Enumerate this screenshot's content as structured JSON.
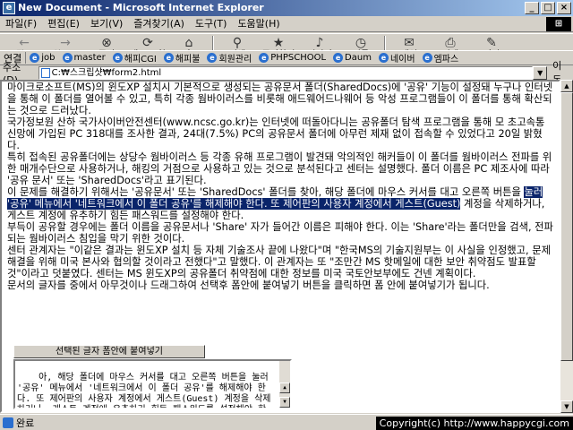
{
  "window": {
    "title": "New Document - Microsoft Internet Explorer",
    "controls": [
      "_",
      "□",
      "×"
    ]
  },
  "menu": [
    "파일(F)",
    "편집(E)",
    "보기(V)",
    "즐겨찾기(A)",
    "도구(T)",
    "도움말(H)"
  ],
  "toolbar": [
    {
      "label": "뒤로",
      "icon": "back-arrow-icon",
      "glyph": "←",
      "disabled": true
    },
    {
      "label": "앞으로",
      "icon": "forward-arrow-icon",
      "glyph": "→",
      "disabled": true
    },
    {
      "label": "중지",
      "icon": "stop-icon",
      "glyph": "⊗",
      "disabled": false
    },
    {
      "label": "새로 고침",
      "icon": "refresh-icon",
      "glyph": "⟳",
      "disabled": false
    },
    {
      "label": "홈",
      "icon": "home-icon",
      "glyph": "⌂",
      "disabled": false
    },
    {
      "label": "검색",
      "icon": "search-icon",
      "glyph": "⚲",
      "disabled": false
    },
    {
      "label": "즐겨찾기",
      "icon": "favorites-icon",
      "glyph": "★",
      "disabled": false
    },
    {
      "label": "미디어",
      "icon": "media-icon",
      "glyph": "♪",
      "disabled": false
    },
    {
      "label": "기록",
      "icon": "history-icon",
      "glyph": "◷",
      "disabled": false
    },
    {
      "label": "메일",
      "icon": "mail-icon",
      "glyph": "✉",
      "disabled": false
    },
    {
      "label": "인쇄",
      "icon": "print-icon",
      "glyph": "⎙",
      "disabled": false
    },
    {
      "label": "편집",
      "icon": "edit-icon",
      "glyph": "✎",
      "disabled": false
    }
  ],
  "links": {
    "lead": "연결",
    "items": [
      "job",
      "master",
      "해피CGI",
      "해피불",
      "회원관리",
      "PHPSCHOOL",
      "Daum",
      "네이버",
      "엠파스"
    ]
  },
  "address": {
    "label": "주소(D)",
    "value": "C:₩스크립샷₩form2.html",
    "go": "이동"
  },
  "article": {
    "p1": "마이크로소프트(MS)의 윈도XP 설치시 기본적으로 생성되는 공유문서 폴더(SharedDocs)에 '공유' 기능이 설정돼 누구나 인터넷을 통해 이 폴더를 열어볼 수 있고, 특히 각종 웜바이러스를 비롯해 애드웨어드나웨어 등 악성 프로그램들이 이 폴더를 통해 확산되는 것으로 드러났다.",
    "p2": "국가정보원 산하 국가사이버안전센터(www.ncsc.go.kr)는 인터넷에 떠돌아다니는 공유폴더 탐색 프로그램을 통해 모 초고속통신망에 가입된 PC 318대를 조사한 결과, 24대(7.5%) PC의 공유문서 폴더에 아무런 제재 없이 접속할 수 있었다고 20일 밝혔다.",
    "p3": "특히 접속된 공유폴더에는 상당수 웜바이러스 등 각종 유해 프로그램이 발견돼 악의적인 해커들이 이 폴더를 웜바이러스 전파를 위한 매개수단으로 사용하거나, 해킹의 거점으로 사용하고 있는 것으로 분석된다고 센터는 설명했다. 폴더 이름은 PC 제조사에 따라 '공유 문서' 또는 'SharedDocs'라고 표기된다.",
    "p4_before": "이 문제를 해결하기 위해서는 '공유문서' 또는 'SharedDocs' 폴더를 찾아, 해당 폴더에 마우스 커서를 대고 오른쪽 버튼을 ",
    "p4_highlight": "눌러 '공유' 메뉴에서 '네트워크에서 이 폴더 공유'를 해제해야 한다. 또 제어판의 사용자 계정에서 게스트(Guest)",
    "p4_after": " 계정을 삭제하거나, 게스트 계정에 유추하기 힘든 패스워드를 설정해야 한다.",
    "p5": "부득이 공유할 경우에는 폴더 이름을 공유문서나 'Share' 자가 들어간 이름은 피해야 한다. 이는 'Share'라는 폴더만을 검색, 전파되는 웜바이러스 침입을 막기 위한 것이다.",
    "p6": "센터 관계자는 \"이같은 결과는 윈도XP 설치 등 자체 기술조사 끝에 나왔다\"며 \"한국MS의 기술지원부는 이 사실을 인정했고, 문제 해결을 위해 미국 본사와 협의할 것이라고 전했다\"고 말했다. 이 관계자는 또 \"조만간 MS 핫메일에 대한 보안 취약점도 발표할 것\"이라고 덧붙였다. 센터는 MS 윈도XP의 공유폴더 취약점에 대한 정보를 미국 국토안보부에도 건넨 계획이다.",
    "note": "문서의 글자를 중에서 아무것이나 드래그하여 선택후 폼안에 붙여넣기 버튼을 클릭하면 폼 안에 붙여넣기가 됩니다."
  },
  "form": {
    "button_label": "선택된 글자 폼안에 붙여넣기",
    "textarea_value": "아, 해당 폴더에 마우스 커서를 대고 오른쪽 버튼을 눌러 '공유' 메뉴에서 '네트워크에서 이 폴더 공유'를 해제해야 한다. 또 제어판의 사용자 계정에서 게스트(Guest) 계정을 삭제하거나, 게스트 계정에 유추하기 힘든 패스워드를 설정해야 한다."
  },
  "status": {
    "text": "완료",
    "copyright": "Copyright(c) http://www.happycgi.com"
  }
}
